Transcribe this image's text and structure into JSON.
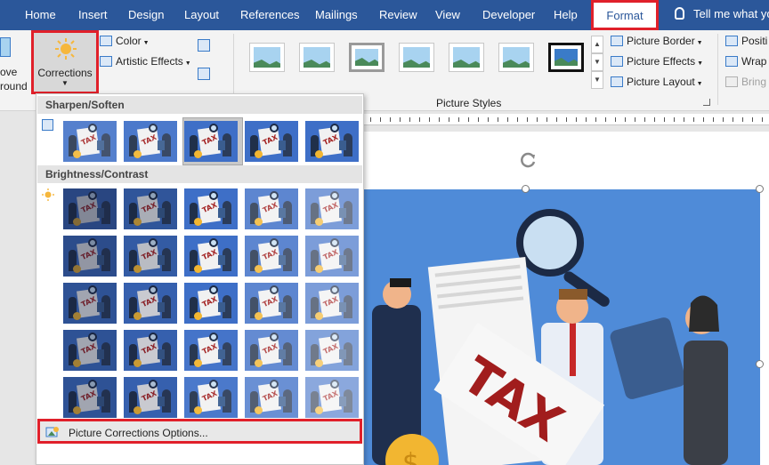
{
  "tabs": [
    "Home",
    "Insert",
    "Design",
    "Layout",
    "References",
    "Mailings",
    "Review",
    "View",
    "Developer",
    "Help",
    "Format"
  ],
  "tell_me": "Tell me what yo",
  "ribbon": {
    "remove_background": [
      "ove",
      "round"
    ],
    "corrections_label": "Corrections",
    "color_label": "Color",
    "artistic_effects_label": "Artistic Effects",
    "picture_border_label": "Picture Border",
    "picture_effects_label": "Picture Effects",
    "picture_layout_label": "Picture Layout",
    "picture_styles_label": "Picture Styles",
    "position_label": "Positi",
    "wrap_label": "Wrap",
    "bring_label": "Bring"
  },
  "menu": {
    "sharpen_heading": "Sharpen/Soften",
    "brightness_heading": "Brightness/Contrast",
    "options_label": "Picture Corrections Options...",
    "sharpen_selected_index": 2,
    "sharpen_thumbs": 5,
    "brightness_rows": 5,
    "brightness_cols": 5
  },
  "picture": {
    "text": "TAX",
    "coin_symbol": "$"
  },
  "colors": {
    "tabbar": "#2b579a",
    "highlight_border": "#e0202a",
    "picture_bg": "#4f8bd8"
  }
}
